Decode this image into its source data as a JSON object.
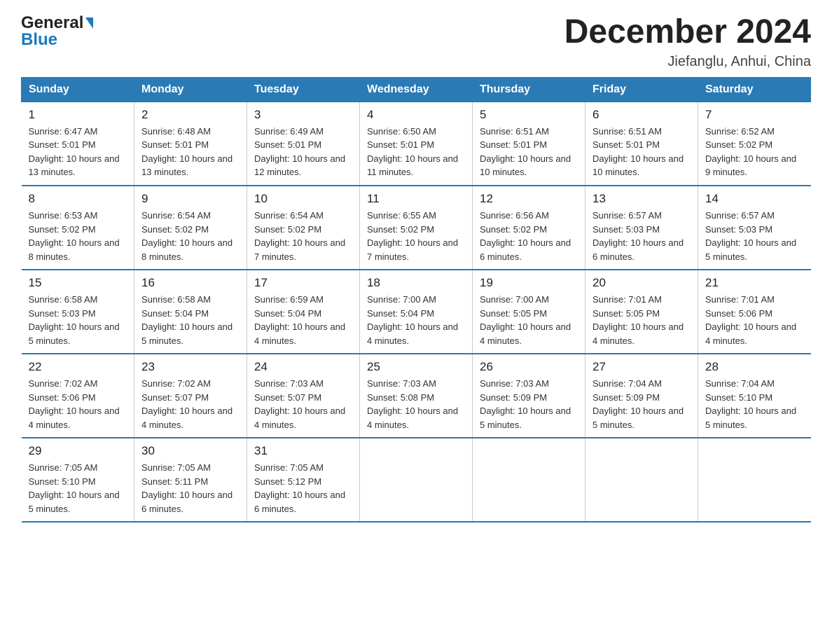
{
  "header": {
    "month_title": "December 2024",
    "location": "Jiefanglu, Anhui, China",
    "logo_general": "General",
    "logo_blue": "Blue"
  },
  "days_of_week": [
    "Sunday",
    "Monday",
    "Tuesday",
    "Wednesday",
    "Thursday",
    "Friday",
    "Saturday"
  ],
  "weeks": [
    [
      {
        "day": "1",
        "sunrise": "6:47 AM",
        "sunset": "5:01 PM",
        "daylight": "10 hours and 13 minutes."
      },
      {
        "day": "2",
        "sunrise": "6:48 AM",
        "sunset": "5:01 PM",
        "daylight": "10 hours and 13 minutes."
      },
      {
        "day": "3",
        "sunrise": "6:49 AM",
        "sunset": "5:01 PM",
        "daylight": "10 hours and 12 minutes."
      },
      {
        "day": "4",
        "sunrise": "6:50 AM",
        "sunset": "5:01 PM",
        "daylight": "10 hours and 11 minutes."
      },
      {
        "day": "5",
        "sunrise": "6:51 AM",
        "sunset": "5:01 PM",
        "daylight": "10 hours and 10 minutes."
      },
      {
        "day": "6",
        "sunrise": "6:51 AM",
        "sunset": "5:01 PM",
        "daylight": "10 hours and 10 minutes."
      },
      {
        "day": "7",
        "sunrise": "6:52 AM",
        "sunset": "5:02 PM",
        "daylight": "10 hours and 9 minutes."
      }
    ],
    [
      {
        "day": "8",
        "sunrise": "6:53 AM",
        "sunset": "5:02 PM",
        "daylight": "10 hours and 8 minutes."
      },
      {
        "day": "9",
        "sunrise": "6:54 AM",
        "sunset": "5:02 PM",
        "daylight": "10 hours and 8 minutes."
      },
      {
        "day": "10",
        "sunrise": "6:54 AM",
        "sunset": "5:02 PM",
        "daylight": "10 hours and 7 minutes."
      },
      {
        "day": "11",
        "sunrise": "6:55 AM",
        "sunset": "5:02 PM",
        "daylight": "10 hours and 7 minutes."
      },
      {
        "day": "12",
        "sunrise": "6:56 AM",
        "sunset": "5:02 PM",
        "daylight": "10 hours and 6 minutes."
      },
      {
        "day": "13",
        "sunrise": "6:57 AM",
        "sunset": "5:03 PM",
        "daylight": "10 hours and 6 minutes."
      },
      {
        "day": "14",
        "sunrise": "6:57 AM",
        "sunset": "5:03 PM",
        "daylight": "10 hours and 5 minutes."
      }
    ],
    [
      {
        "day": "15",
        "sunrise": "6:58 AM",
        "sunset": "5:03 PM",
        "daylight": "10 hours and 5 minutes."
      },
      {
        "day": "16",
        "sunrise": "6:58 AM",
        "sunset": "5:04 PM",
        "daylight": "10 hours and 5 minutes."
      },
      {
        "day": "17",
        "sunrise": "6:59 AM",
        "sunset": "5:04 PM",
        "daylight": "10 hours and 4 minutes."
      },
      {
        "day": "18",
        "sunrise": "7:00 AM",
        "sunset": "5:04 PM",
        "daylight": "10 hours and 4 minutes."
      },
      {
        "day": "19",
        "sunrise": "7:00 AM",
        "sunset": "5:05 PM",
        "daylight": "10 hours and 4 minutes."
      },
      {
        "day": "20",
        "sunrise": "7:01 AM",
        "sunset": "5:05 PM",
        "daylight": "10 hours and 4 minutes."
      },
      {
        "day": "21",
        "sunrise": "7:01 AM",
        "sunset": "5:06 PM",
        "daylight": "10 hours and 4 minutes."
      }
    ],
    [
      {
        "day": "22",
        "sunrise": "7:02 AM",
        "sunset": "5:06 PM",
        "daylight": "10 hours and 4 minutes."
      },
      {
        "day": "23",
        "sunrise": "7:02 AM",
        "sunset": "5:07 PM",
        "daylight": "10 hours and 4 minutes."
      },
      {
        "day": "24",
        "sunrise": "7:03 AM",
        "sunset": "5:07 PM",
        "daylight": "10 hours and 4 minutes."
      },
      {
        "day": "25",
        "sunrise": "7:03 AM",
        "sunset": "5:08 PM",
        "daylight": "10 hours and 4 minutes."
      },
      {
        "day": "26",
        "sunrise": "7:03 AM",
        "sunset": "5:09 PM",
        "daylight": "10 hours and 5 minutes."
      },
      {
        "day": "27",
        "sunrise": "7:04 AM",
        "sunset": "5:09 PM",
        "daylight": "10 hours and 5 minutes."
      },
      {
        "day": "28",
        "sunrise": "7:04 AM",
        "sunset": "5:10 PM",
        "daylight": "10 hours and 5 minutes."
      }
    ],
    [
      {
        "day": "29",
        "sunrise": "7:05 AM",
        "sunset": "5:10 PM",
        "daylight": "10 hours and 5 minutes."
      },
      {
        "day": "30",
        "sunrise": "7:05 AM",
        "sunset": "5:11 PM",
        "daylight": "10 hours and 6 minutes."
      },
      {
        "day": "31",
        "sunrise": "7:05 AM",
        "sunset": "5:12 PM",
        "daylight": "10 hours and 6 minutes."
      },
      null,
      null,
      null,
      null
    ]
  ]
}
